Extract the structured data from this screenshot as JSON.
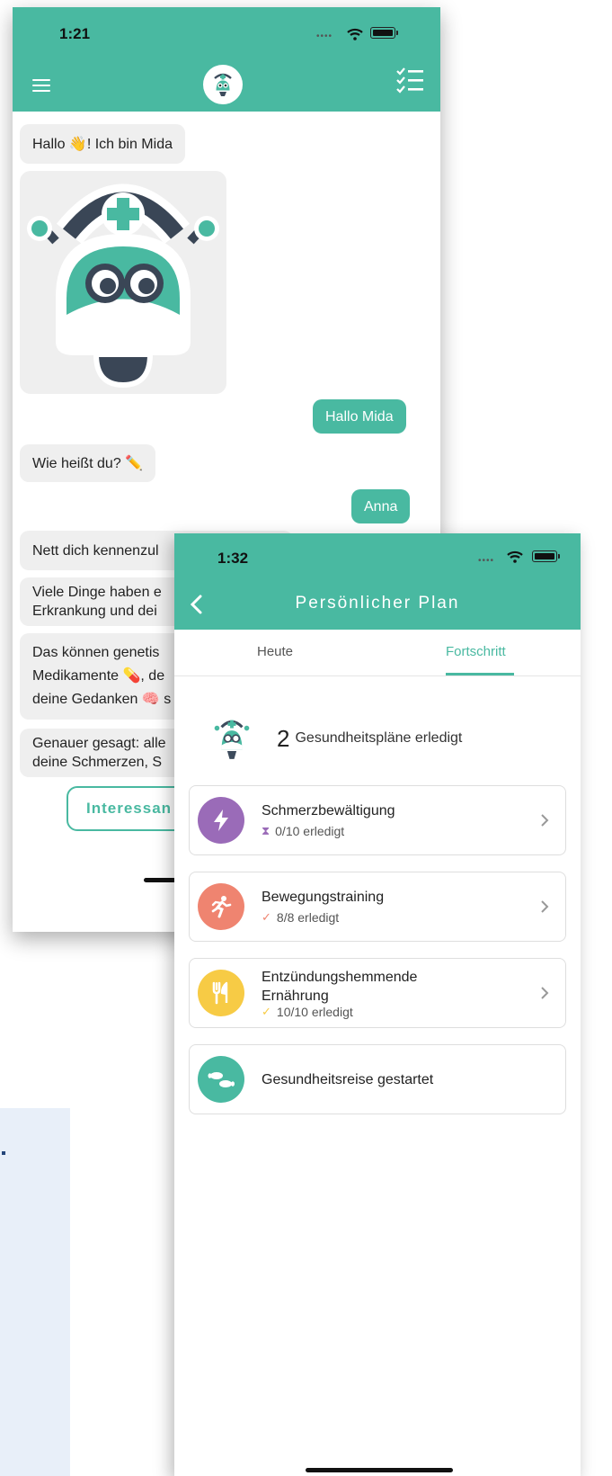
{
  "colors": {
    "brand": "#49b9a1",
    "purple": "#9a6bb8",
    "coral": "#ef8470",
    "yellow": "#f7cb45",
    "teal": "#49b9a1"
  },
  "chat_screen": {
    "status_time": "1:21",
    "header_icons": [
      "menu-icon",
      "mida-logo-icon",
      "checklist-icon"
    ],
    "messages": [
      {
        "side": "left",
        "lines": [
          "Hallo 👋! Ich bin Mida"
        ]
      },
      {
        "side": "right",
        "lines": [
          "Hallo Mida"
        ]
      },
      {
        "side": "left",
        "lines": [
          "Wie heißt du? ✏️"
        ]
      },
      {
        "side": "right",
        "lines": [
          "Anna"
        ]
      },
      {
        "side": "left",
        "lines": [
          "Nett dich kennenzul"
        ]
      },
      {
        "side": "left",
        "lines": [
          "Viele Dinge haben e",
          "Erkrankung und dei"
        ]
      },
      {
        "side": "left",
        "lines": [
          "Das können genetis",
          "Medikamente 💊, de",
          "deine Gedanken 🧠 s"
        ]
      },
      {
        "side": "left",
        "lines": [
          "Genauer gesagt: alle",
          "deine Schmerzen, S"
        ]
      }
    ],
    "button_label": "Interessan"
  },
  "plan_screen": {
    "status_time": "1:32",
    "title": "Persönlicher Plan",
    "tabs": [
      {
        "label": "Heute",
        "active": false
      },
      {
        "label": "Fortschritt",
        "active": true
      }
    ],
    "summary": {
      "count": "2",
      "text": "Gesundheitspläne erledigt"
    },
    "plans": [
      {
        "title": "Schmerzbewältigung",
        "status": "0/10 erledigt",
        "icon": "lightning-icon",
        "status_icon": "hourglass-icon",
        "color": "#9a6bb8"
      },
      {
        "title": "Bewegungstraining",
        "status": "8/8 erledigt",
        "icon": "running-person-icon",
        "status_icon": "check-icon",
        "color": "#ef8470"
      },
      {
        "title_lines": [
          "Entzündungshemmende",
          "Ernährung"
        ],
        "status": "10/10 erledigt",
        "icon": "fork-knife-icon",
        "status_icon": "check-icon",
        "color": "#f7cb45"
      },
      {
        "title": "Gesundheitsreise gestartet",
        "icon": "footprints-icon",
        "color": "#49b9a1"
      }
    ]
  }
}
